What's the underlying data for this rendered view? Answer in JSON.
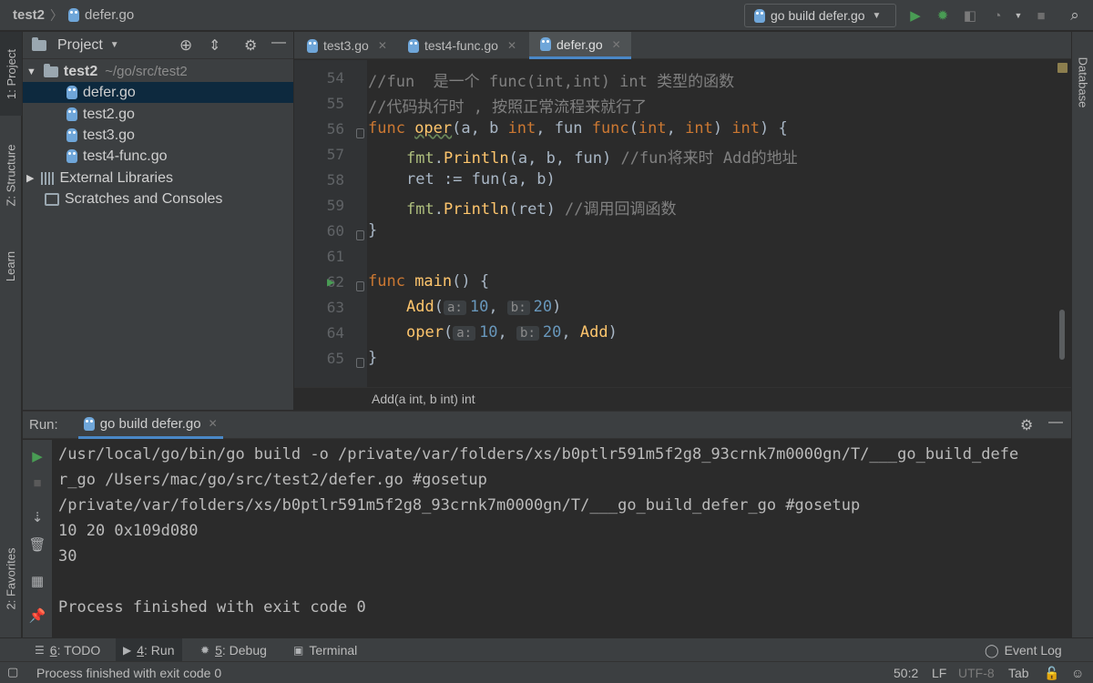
{
  "breadcrumb": {
    "project": "test2",
    "file": "defer.go"
  },
  "run_config": {
    "label": "go build defer.go"
  },
  "colors": {
    "accent": "#4a88c7",
    "run_green": "#499c54",
    "selection": "#0d293e"
  },
  "left_strip": {
    "project": "1: Project",
    "structure": "Z: Structure",
    "learn": "Learn",
    "favorites": "2: Favorites"
  },
  "right_strip": {
    "database": "Database"
  },
  "project_panel": {
    "title": "Project",
    "root": {
      "name": "test2",
      "path": "~/go/src/test2"
    },
    "files": [
      "defer.go",
      "test2.go",
      "test3.go",
      "test4-func.go"
    ],
    "external": "External Libraries",
    "scratches": "Scratches and Consoles"
  },
  "editor": {
    "tabs": [
      "test3.go",
      "test4-func.go",
      "defer.go"
    ],
    "active_tab": "defer.go",
    "line_numbers": [
      "54",
      "55",
      "56",
      "57",
      "58",
      "59",
      "60",
      "61",
      "62",
      "63",
      "64",
      "65"
    ],
    "lines": {
      "l54": "//fun  是一个 func(int,int) int 类型的函数",
      "l55": "//代码执行时 , 按照正常流程来就行了",
      "l56_kw": "func ",
      "l56_fn": "oper",
      "l56_a": "(a, b ",
      "l56_int1": "int",
      "l56_b": ", fun ",
      "l56_func": "func",
      "l56_c": "(",
      "l56_int2": "int",
      "l56_d": ", ",
      "l56_int3": "int",
      "l56_e": ") ",
      "l56_int4": "int",
      "l56_f": ") {",
      "l57_pkg": "fmt",
      "l57_a": ".",
      "l57_fn": "Println",
      "l57_b": "(a, b, fun) ",
      "l57_cm": "//fun将来时 Add的地址",
      "l58": "ret := fun(a, b)",
      "l59_pkg": "fmt",
      "l59_a": ".",
      "l59_fn": "Println",
      "l59_b": "(ret) ",
      "l59_cm": "//调用回调函数",
      "l60": "}",
      "l62_kw": "func ",
      "l62_fn": "main",
      "l62_a": "() {",
      "l63_fn": "Add",
      "l63_a": "(",
      "l63_h1": "a:",
      "l63_n1": "10",
      "l63_b": ", ",
      "l63_h2": "b:",
      "l63_n2": "20",
      "l63_c": ")",
      "l64_fn": "oper",
      "l64_a": "(",
      "l64_h1": "a:",
      "l64_n1": "10",
      "l64_b": ", ",
      "l64_h2": "b:",
      "l64_n2": "20",
      "l64_c": ", ",
      "l64_add": "Add",
      "l64_d": ")",
      "l65": "}"
    },
    "signature_hint": "Add(a int, b int) int"
  },
  "run_panel": {
    "label": "Run:",
    "tab": "go build defer.go",
    "output": [
      "/usr/local/go/bin/go build -o /private/var/folders/xs/b0ptlr591m5f2g8_93crnk7m0000gn/T/___go_build_defe",
      "r_go /Users/mac/go/src/test2/defer.go #gosetup",
      "/private/var/folders/xs/b0ptlr591m5f2g8_93crnk7m0000gn/T/___go_build_defer_go #gosetup",
      "10 20 0x109d080",
      "30",
      "",
      "Process finished with exit code 0"
    ]
  },
  "bottom_tabs": {
    "todo_num": "6",
    "todo": ": TODO",
    "run_num": "4",
    "run": ": Run",
    "debug_num": "5",
    "debug": ": Debug",
    "terminal": "Terminal",
    "event_log": "Event Log"
  },
  "status_bar": {
    "message": "Process finished with exit code 0",
    "position": "50:2",
    "line_sep": "LF",
    "encoding": "UTF-8",
    "indent": "Tab"
  }
}
